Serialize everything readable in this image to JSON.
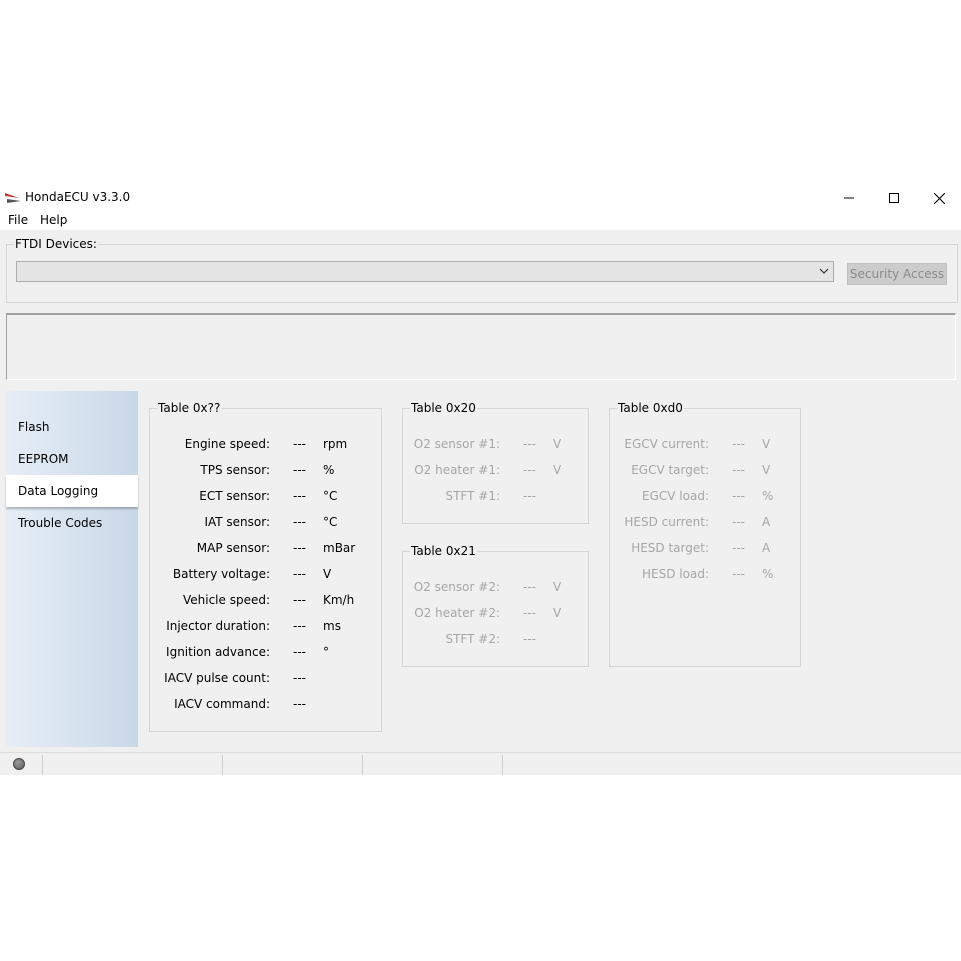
{
  "window": {
    "title": "HondaECU v3.3.0",
    "icons": {
      "app": "honda-logo-icon",
      "minimize": "minimize-icon",
      "maximize": "maximize-icon",
      "close": "close-icon"
    }
  },
  "menu": {
    "file": "File",
    "help": "Help"
  },
  "ftdi": {
    "label": "FTDI Devices:",
    "selected": "",
    "security_button": "Security Access"
  },
  "tabs": [
    {
      "label": "Flash"
    },
    {
      "label": "EEPROM"
    },
    {
      "label": "Data Logging",
      "selected": true
    },
    {
      "label": "Trouble Codes"
    }
  ],
  "table_main": {
    "title": "Table 0x??",
    "rows": [
      {
        "label": "Engine speed:",
        "value": "---",
        "unit": "rpm"
      },
      {
        "label": "TPS sensor:",
        "value": "---",
        "unit": "%"
      },
      {
        "label": "ECT sensor:",
        "value": "---",
        "unit": "°C"
      },
      {
        "label": "IAT sensor:",
        "value": "---",
        "unit": "°C"
      },
      {
        "label": "MAP sensor:",
        "value": "---",
        "unit": "mBar"
      },
      {
        "label": "Battery voltage:",
        "value": "---",
        "unit": "V"
      },
      {
        "label": "Vehicle speed:",
        "value": "---",
        "unit": "Km/h"
      },
      {
        "label": "Injector duration:",
        "value": "---",
        "unit": "ms"
      },
      {
        "label": "Ignition advance:",
        "value": "---",
        "unit": "°"
      },
      {
        "label": "IACV pulse count:",
        "value": "---",
        "unit": ""
      },
      {
        "label": "IACV command:",
        "value": "---",
        "unit": ""
      }
    ]
  },
  "table_20": {
    "title": "Table 0x20",
    "rows": [
      {
        "label": "O2 sensor #1:",
        "value": "---",
        "unit": "V"
      },
      {
        "label": "O2 heater #1:",
        "value": "---",
        "unit": "V"
      },
      {
        "label": "STFT #1:",
        "value": "---",
        "unit": ""
      }
    ]
  },
  "table_21": {
    "title": "Table 0x21",
    "rows": [
      {
        "label": "O2 sensor #2:",
        "value": "---",
        "unit": "V"
      },
      {
        "label": "O2 heater #2:",
        "value": "---",
        "unit": "V"
      },
      {
        "label": "STFT #2:",
        "value": "---",
        "unit": ""
      }
    ]
  },
  "table_d0": {
    "title": "Table 0xd0",
    "rows": [
      {
        "label": "EGCV current:",
        "value": "---",
        "unit": "V"
      },
      {
        "label": "EGCV target:",
        "value": "---",
        "unit": "V"
      },
      {
        "label": "EGCV load:",
        "value": "---",
        "unit": "%"
      },
      {
        "label": "HESD current:",
        "value": "---",
        "unit": "A"
      },
      {
        "label": "HESD target:",
        "value": "---",
        "unit": "A"
      },
      {
        "label": "HESD load:",
        "value": "---",
        "unit": "%"
      }
    ]
  },
  "statusbar": {
    "led_icon": "status-led-icon"
  },
  "colors": {
    "disabled_text": "#a6a6a6",
    "tab_gradient_start": "#e6eef6",
    "tab_gradient_end": "#c9d8e8"
  }
}
